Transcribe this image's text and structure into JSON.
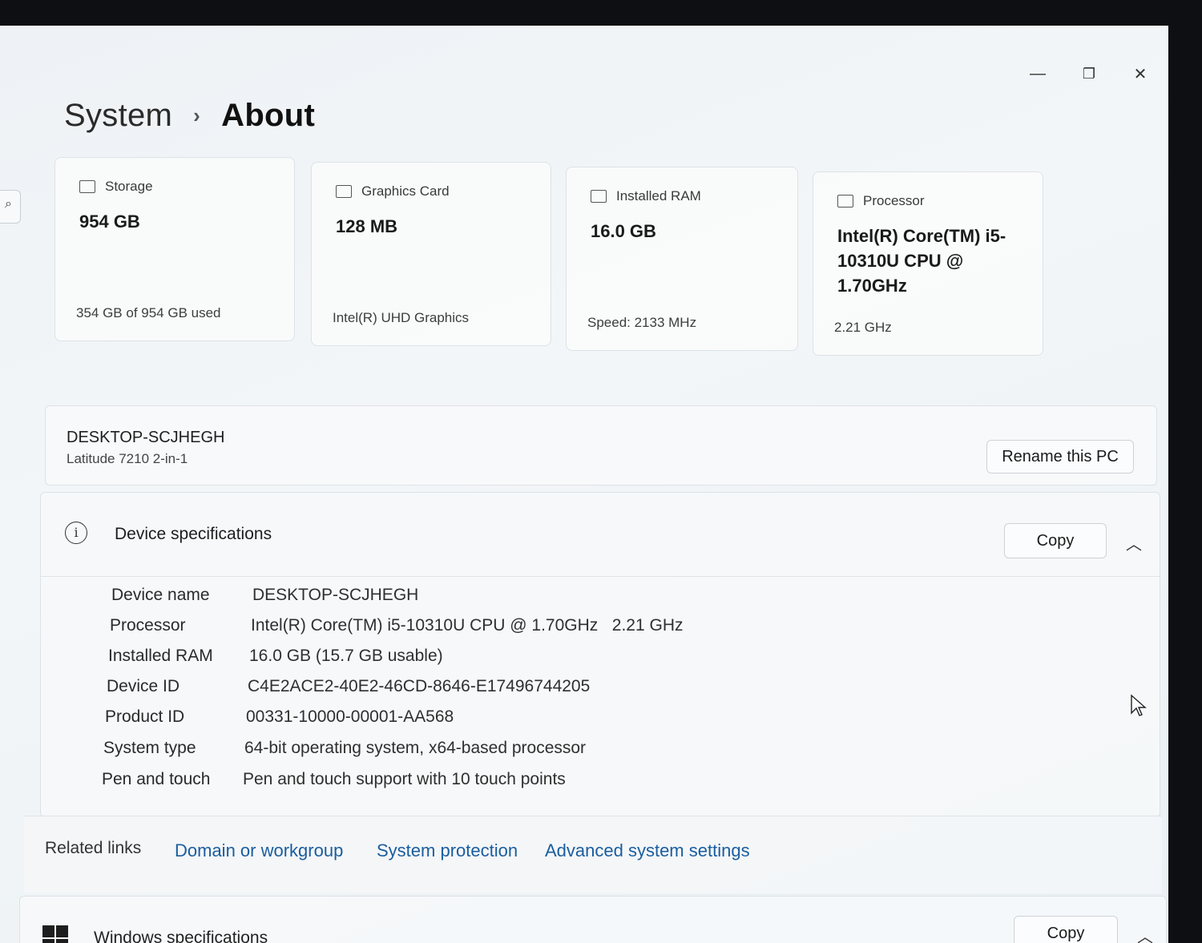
{
  "window": {
    "minimize_glyph": "—",
    "restore_glyph": "❐",
    "close_glyph": "✕"
  },
  "breadcrumb": {
    "parent": "System",
    "separator": "›",
    "current": "About"
  },
  "cards": [
    {
      "label": "Storage",
      "value": "954 GB",
      "sub": "354 GB of 954 GB used",
      "icon": "storage-icon"
    },
    {
      "label": "Graphics Card",
      "value": "128 MB",
      "sub": "Intel(R) UHD Graphics",
      "icon": "graphics-card-icon"
    },
    {
      "label": "Installed RAM",
      "value": "16.0 GB",
      "sub": "Speed: 2133 MHz",
      "icon": "ram-icon"
    },
    {
      "label": "Processor",
      "value": "Intel(R) Core(TM) i5-10310U CPU @ 1.70GHz",
      "sub": "2.21 GHz",
      "icon": "processor-icon"
    }
  ],
  "pc": {
    "name": "DESKTOP-SCJHEGH",
    "model": "Latitude 7210 2-in-1",
    "rename_label": "Rename this PC"
  },
  "device_specs": {
    "title": "Device specifications",
    "copy_label": "Copy",
    "rows": [
      {
        "key": "Device name",
        "value": "DESKTOP-SCJHEGH"
      },
      {
        "key": "Processor",
        "value": "Intel(R) Core(TM) i5-10310U CPU @ 1.70GHz   2.21 GHz"
      },
      {
        "key": "Installed RAM",
        "value": "16.0 GB (15.7 GB usable)"
      },
      {
        "key": "Device ID",
        "value": "C4E2ACE2-40E2-46CD-8646-E17496744205"
      },
      {
        "key": "Product ID",
        "value": "00331-10000-00001-AA568"
      },
      {
        "key": "System type",
        "value": "64-bit operating system, x64-based processor"
      },
      {
        "key": "Pen and touch",
        "value": "Pen and touch support with 10 touch points"
      }
    ]
  },
  "related_links": {
    "title": "Related links",
    "links": [
      "Domain or workgroup",
      "System protection",
      "Advanced system settings"
    ]
  },
  "windows_specs": {
    "title": "Windows specifications",
    "copy_label": "Copy"
  }
}
